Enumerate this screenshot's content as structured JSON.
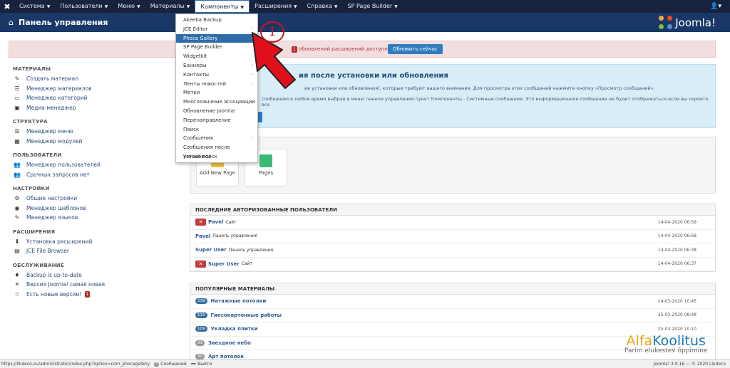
{
  "topbar": {
    "menu": [
      {
        "label": "Система",
        "caret": "▼"
      },
      {
        "label": "Пользователи",
        "caret": "▼"
      },
      {
        "label": "Меню",
        "caret": "▼"
      },
      {
        "label": "Материалы",
        "caret": "▼"
      },
      {
        "label": "Компоненты",
        "caret": "▼",
        "active": true
      },
      {
        "label": "Расширения",
        "caret": "▼"
      },
      {
        "label": "Справка",
        "caret": "▼"
      },
      {
        "label": "SP Page Builder",
        "caret": "▼"
      }
    ],
    "user_icon": "user-icon"
  },
  "header": {
    "title": "Панель управления",
    "brand": "Joomla!"
  },
  "alert": {
    "count": "1",
    "message": "обновлений расширений доступно:",
    "button": "Обновить сейчас"
  },
  "sidebar": {
    "sections": [
      {
        "title": "МАТЕРИАЛЫ",
        "links": [
          {
            "label": "Создать материал",
            "icon": "✎"
          },
          {
            "label": "Менеджер материалов",
            "icon": "☰"
          },
          {
            "label": "Менеджер категорий",
            "icon": "▭"
          },
          {
            "label": "Медиа-менеджер",
            "icon": "▣"
          }
        ]
      },
      {
        "title": "СТРУКТУРА",
        "links": [
          {
            "label": "Менеджер меню",
            "icon": "☰"
          },
          {
            "label": "Менеджер модулей",
            "icon": "▦"
          }
        ]
      },
      {
        "title": "ПОЛЬЗОВАТЕЛИ",
        "links": [
          {
            "label": "Менеджер пользователей",
            "icon": "👥"
          },
          {
            "label": "Срочных запросов нет",
            "icon": "👥"
          }
        ]
      },
      {
        "title": "НАСТРОЙКИ",
        "links": [
          {
            "label": "Общие настройки",
            "icon": "⚙"
          },
          {
            "label": "Менеджер шаблонов",
            "icon": "◉"
          },
          {
            "label": "Менеджер языков",
            "icon": "✎"
          }
        ]
      },
      {
        "title": "РАСШИРЕНИЯ",
        "links": [
          {
            "label": "Установка расширений",
            "icon": "⬇"
          },
          {
            "label": "JCE File Browser",
            "icon": "▤"
          }
        ]
      },
      {
        "title": "ОБСЛУЖИВАНИЕ",
        "links": [
          {
            "label": "Backup is up-to-date",
            "icon": "♦"
          },
          {
            "label": "Версия Joomla! самая новая",
            "icon": "✕"
          },
          {
            "label": "Есть новые версии!",
            "icon": "☆",
            "count": "1"
          }
        ]
      }
    ]
  },
  "info": {
    "heading": "ия после установки или обновления",
    "line1": "ие установки или обновления), которые требуют вашего внимания. Для просмотра этих сообщений нажмите кнопку «Просмотр сообщений».",
    "line2": "сообщения в любое время выбрав в меню панели управления пункт Компоненты - Системные сообщения. Это информационное сообщение не будет отображаться если вы скроете все"
  },
  "quick": {
    "tiles": [
      {
        "label": "Add New Page",
        "color": "#f2c037"
      },
      {
        "label": "Pages",
        "color": "#3cba78"
      }
    ]
  },
  "users_panel": {
    "title": "ПОСЛЕДНИЕ АВТОРИЗОВАННЫЕ ПОЛЬЗОВАТЕЛИ",
    "rows": [
      {
        "name": "Pavel",
        "context": "Сайт",
        "date": "14-04-2020 06:59",
        "logout": true
      },
      {
        "name": "Pavel",
        "context": "Панель управления",
        "date": "14-04-2020 06:58",
        "logout": false
      },
      {
        "name": "Super User",
        "context": "Панель управления",
        "date": "14-04-2020 06:38",
        "logout": false
      },
      {
        "name": "Super User",
        "context": "Сайт",
        "date": "14-04-2020 06:37",
        "logout": true
      }
    ]
  },
  "popular_panel": {
    "title": "ПОПУЛЯРНЫЕ МАТЕРИАЛЫ",
    "rows": [
      {
        "hits": "239",
        "name": "Натяжные потолки",
        "date": "24-03-2020 10:45",
        "grey": false
      },
      {
        "hits": "115",
        "name": "Гипсокартонные работы",
        "date": "25-03-2020 08:48",
        "grey": false
      },
      {
        "hits": "109",
        "name": "Укладка плитки",
        "date": "25-03-2020 10:10",
        "grey": false
      },
      {
        "hits": "31",
        "name": "Звездное небо",
        "date": "",
        "grey": true
      },
      {
        "hits": "30",
        "name": "Арт потолок",
        "date": "",
        "grey": true
      }
    ]
  },
  "dropdown": {
    "items": [
      {
        "label": "Akeeba Backup",
        "sub": false
      },
      {
        "label": "JCE Editor",
        "sub": true
      },
      {
        "label": "Phoca Gallery",
        "sub": true,
        "highlight": true
      },
      {
        "label": "SP Page Builder",
        "sub": false
      },
      {
        "label": "Widgetkit",
        "sub": false
      },
      {
        "label": "Баннеры",
        "sub": true
      },
      {
        "label": "Контакты",
        "sub": true
      },
      {
        "label": "Ленты новостей",
        "sub": true
      },
      {
        "label": "Метки",
        "sub": false
      },
      {
        "label": "Многоязычные ассоциации",
        "sub": false
      },
      {
        "label": "Обновление Joomla!",
        "sub": false
      },
      {
        "label": "Перенаправление",
        "sub": false
      },
      {
        "label": "Поиск",
        "sub": false
      },
      {
        "label": "Сообщения",
        "sub": true
      },
      {
        "label": "Сообщения после установки",
        "sub": false
      },
      {
        "label": "Умный поиск",
        "sub": false
      }
    ],
    "sub_glyph": "›"
  },
  "callout": {
    "number": "1"
  },
  "statusbar": {
    "url": "https://likdeco.eu/administrator/index.php?option=com_phocagallery",
    "messages_count": "0",
    "messages_label": "Сообщений",
    "logout_label": "Выйти",
    "version": "Joomla! 3.9.16 — © 2020 Likdeco"
  },
  "watermark": {
    "brand_a": "Alfa",
    "brand_b": "Koolitus",
    "tagline": "Parim elukestev õppimine"
  },
  "colors": {
    "topbar": "#17233d",
    "header": "#1a3867",
    "accent": "#2f6ba9",
    "danger": "#c43c3c"
  }
}
